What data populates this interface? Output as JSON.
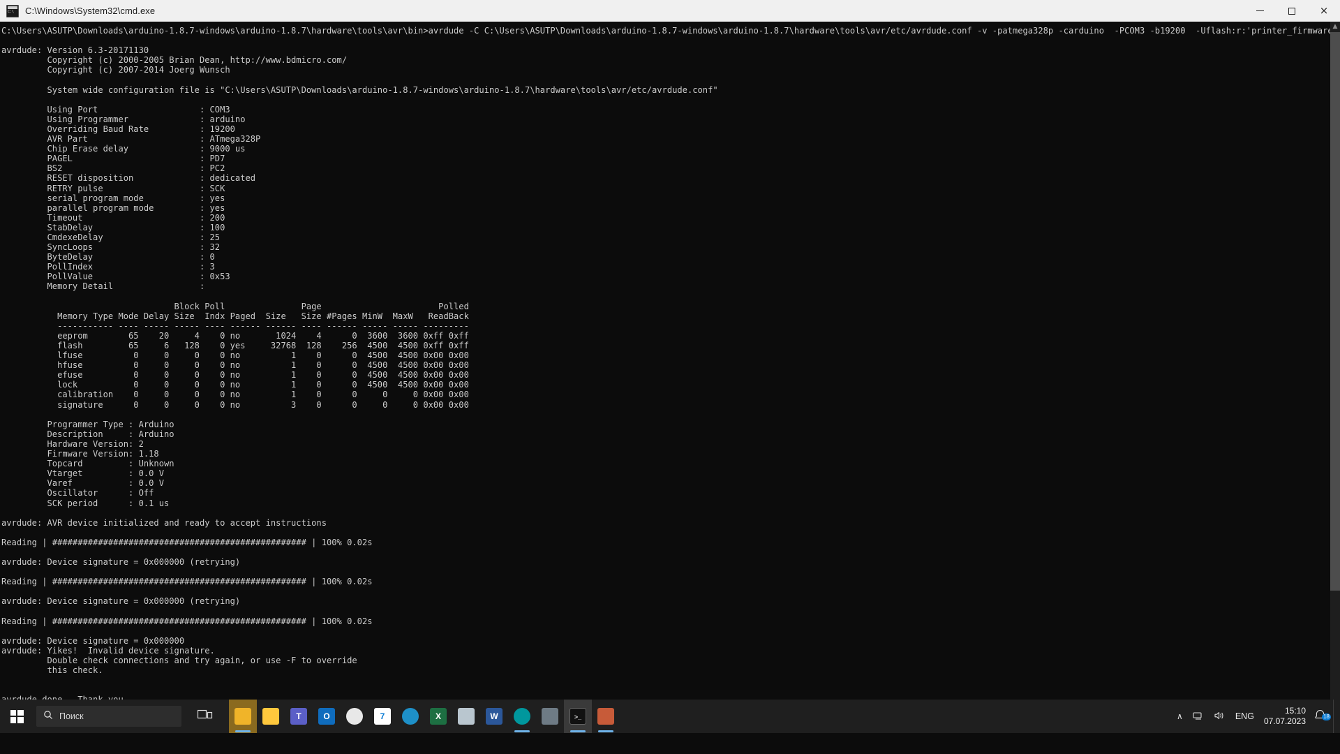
{
  "window": {
    "title": "C:\\Windows\\System32\\cmd.exe",
    "icon": "cmd-icon",
    "controls": {
      "minimize": "minimize-button",
      "maximize": "maximize-button",
      "close": "close-button",
      "close_glyph": "×"
    }
  },
  "scrollbar": {
    "up_arrow": "▲",
    "down_arrow": "▼"
  },
  "console": {
    "background": "#0c0c0c",
    "foreground": "#cccccc",
    "lines": [
      "C:\\Users\\ASUTP\\Downloads\\arduino-1.8.7-windows\\arduino-1.8.7\\hardware\\tools\\avr\\bin>avrdude -C C:\\Users\\ASUTP\\Downloads\\arduino-1.8.7-windows\\arduino-1.8.7\\hardware\\tools\\avr/etc/avrdude.conf -v -patmega328p -carduino  -PCOM3 -b19200  -Uflash:r:'printer_firmware'.hex:i",
      "",
      "avrdude: Version 6.3-20171130",
      "         Copyright (c) 2000-2005 Brian Dean, http://www.bdmicro.com/",
      "         Copyright (c) 2007-2014 Joerg Wunsch",
      "",
      "         System wide configuration file is \"C:\\Users\\ASUTP\\Downloads\\arduino-1.8.7-windows\\arduino-1.8.7\\hardware\\tools\\avr/etc/avrdude.conf\"",
      "",
      "         Using Port                    : COM3",
      "         Using Programmer              : arduino",
      "         Overriding Baud Rate          : 19200",
      "         AVR Part                      : ATmega328P",
      "         Chip Erase delay              : 9000 us",
      "         PAGEL                         : PD7",
      "         BS2                           : PC2",
      "         RESET disposition             : dedicated",
      "         RETRY pulse                   : SCK",
      "         serial program mode           : yes",
      "         parallel program mode         : yes",
      "         Timeout                       : 200",
      "         StabDelay                     : 100",
      "         CmdexeDelay                   : 25",
      "         SyncLoops                     : 32",
      "         ByteDelay                     : 0",
      "         PollIndex                     : 3",
      "         PollValue                     : 0x53",
      "         Memory Detail                 :",
      "",
      "                                  Block Poll               Page                       Polled",
      "           Memory Type Mode Delay Size  Indx Paged  Size   Size #Pages MinW  MaxW   ReadBack",
      "           ----------- ---- ----- ----- ---- ------ ------ ---- ------ ----- ----- ---------",
      "           eeprom        65    20     4    0 no       1024    4      0  3600  3600 0xff 0xff",
      "           flash         65     6   128    0 yes     32768  128    256  4500  4500 0xff 0xff",
      "           lfuse          0     0     0    0 no          1    0      0  4500  4500 0x00 0x00",
      "           hfuse          0     0     0    0 no          1    0      0  4500  4500 0x00 0x00",
      "           efuse          0     0     0    0 no          1    0      0  4500  4500 0x00 0x00",
      "           lock           0     0     0    0 no          1    0      0  4500  4500 0x00 0x00",
      "           calibration    0     0     0    0 no          1    0      0     0     0 0x00 0x00",
      "           signature      0     0     0    0 no          3    0      0     0     0 0x00 0x00",
      "",
      "         Programmer Type : Arduino",
      "         Description     : Arduino",
      "         Hardware Version: 2",
      "         Firmware Version: 1.18",
      "         Topcard         : Unknown",
      "         Vtarget         : 0.0 V",
      "         Varef           : 0.0 V",
      "         Oscillator      : Off",
      "         SCK period      : 0.1 us",
      "",
      "avrdude: AVR device initialized and ready to accept instructions",
      "",
      "Reading | ################################################## | 100% 0.02s",
      "",
      "avrdude: Device signature = 0x000000 (retrying)",
      "",
      "Reading | ################################################## | 100% 0.02s",
      "",
      "avrdude: Device signature = 0x000000 (retrying)",
      "",
      "Reading | ################################################## | 100% 0.02s",
      "",
      "avrdude: Device signature = 0x000000",
      "avrdude: Yikes!  Invalid device signature.",
      "         Double check connections and try again, or use -F to override",
      "         this check.",
      "",
      "",
      "avrdude done.  Thank you.",
      ""
    ]
  },
  "taskbar": {
    "start": "windows-start-button",
    "search": {
      "placeholder": "Поиск",
      "icon": "search-icon"
    },
    "taskview": "task-view-button",
    "apps": [
      {
        "name": "explorer-folder-app",
        "label": "",
        "color": "#f0b429",
        "icon": "folder-icon"
      },
      {
        "name": "file-explorer-app",
        "label": "",
        "color": "#ffc83d",
        "icon": "folder-icon"
      },
      {
        "name": "microsoft-teams-app",
        "label": "",
        "color": "#5b5fc7",
        "icon": "teams-icon"
      },
      {
        "name": "outlook-app",
        "label": "O",
        "color": "#0f6cbd",
        "icon": "outlook-icon"
      },
      {
        "name": "google-chrome-app",
        "label": "",
        "color": "#e8e8e8",
        "icon": "chrome-icon"
      },
      {
        "name": "7zip-app",
        "label": "7",
        "color": "#ffffff",
        "icon": "sevenzip-icon"
      },
      {
        "name": "microsoft-edge-app",
        "label": "",
        "color": "#1e90c8",
        "icon": "edge-icon"
      },
      {
        "name": "microsoft-excel-app",
        "label": "X",
        "color": "#1d6f42",
        "icon": "excel-icon"
      },
      {
        "name": "notepad-app",
        "label": "",
        "color": "#b9c6cf",
        "icon": "notepad-icon"
      },
      {
        "name": "microsoft-word-app",
        "label": "W",
        "color": "#2b579a",
        "icon": "word-icon"
      },
      {
        "name": "arduino-ide-app",
        "label": "",
        "color": "#00979d",
        "icon": "arduino-icon"
      },
      {
        "name": "printer-utility-app",
        "label": "",
        "color": "#6e7b85",
        "icon": "printer-icon"
      },
      {
        "name": "command-prompt-app",
        "label": "",
        "color": "#1a1a1a",
        "icon": "cmd-icon"
      },
      {
        "name": "pronterface-app",
        "label": "",
        "color": "#c75b39",
        "icon": "pronterface-icon"
      }
    ],
    "tray": {
      "chevron": "∧",
      "network": "network-icon",
      "volume": "ᵈ)",
      "language": "ENG"
    },
    "clock": {
      "time": "15:10",
      "date": "07.07.2023"
    },
    "notifications": {
      "icon": "notification-bell-icon",
      "count": "18"
    }
  }
}
